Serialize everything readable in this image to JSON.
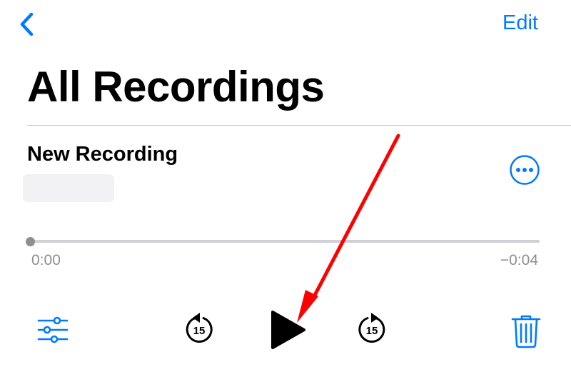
{
  "nav": {
    "edit_label": "Edit"
  },
  "page": {
    "title": "All Recordings"
  },
  "recording": {
    "name": "New Recording",
    "elapsed": "0:00",
    "remaining": "−0:04",
    "progress": 0
  },
  "controls": {
    "skip_back_seconds": "15",
    "skip_forward_seconds": "15"
  },
  "colors": {
    "accent": "#007aff",
    "annotation_arrow": "#ff0000"
  },
  "icons": [
    "back-chevron-icon",
    "more-options-icon",
    "options-sliders-icon",
    "skip-back-15-icon",
    "play-icon",
    "skip-forward-15-icon",
    "trash-icon"
  ]
}
